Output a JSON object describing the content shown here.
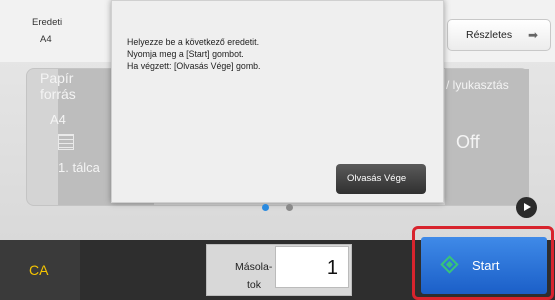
{
  "header": {
    "original_label": "Eredeti",
    "original_value": "A4",
    "details_button": "Részletes",
    "details_arrow": "➡"
  },
  "background_cards": {
    "paper_source_line1": "Papír",
    "paper_source_line2": "forrás",
    "paper_size": "A4",
    "tray": "1. tálca",
    "staple_punch": "/ lyukasztás",
    "off_value": "Off"
  },
  "dialog": {
    "line1": "Helyezze be a következő eredetit.",
    "line2": "Nyomja meg a [Start] gombot.",
    "line3": "Ha végzett: [Olvasás Vége] gomb.",
    "finish_button": "Olvasás Vége"
  },
  "pager": {
    "active_page": 1,
    "page_count": 2
  },
  "bottom": {
    "ca_button": "CA",
    "copies_label_line1": "Másola-",
    "copies_label_line2": "tok",
    "copies_value": "1",
    "start_button": "Start"
  },
  "colors": {
    "ca_text": "#f5c400",
    "start_bg": "#2b74d8",
    "start_icon": "#37c47a",
    "highlight": "#d8242d",
    "active_dot": "#2a8adf"
  }
}
